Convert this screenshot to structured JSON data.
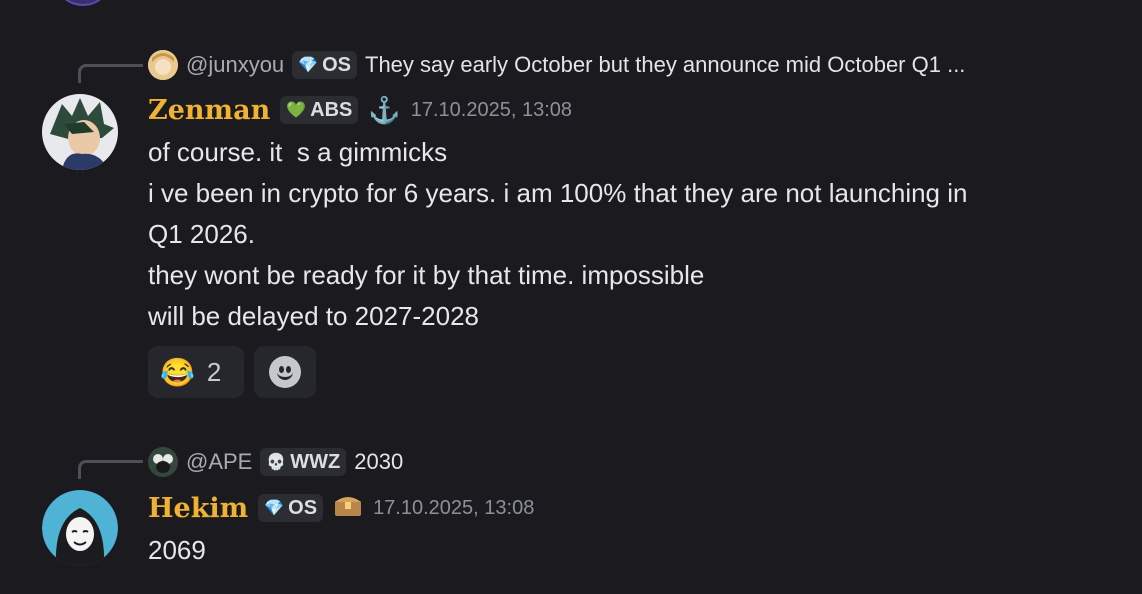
{
  "messages": [
    {
      "reply": {
        "username": "@junxyou",
        "tag": "OS",
        "tag_icon": "diamond",
        "text": "They say early October but they announce mid October  Q1 ..."
      },
      "author": "Zenman",
      "tag": "ABS",
      "tag_icon": "green-heart",
      "role_icon": "anchor",
      "timestamp": "17.10.2025, 13:08",
      "lines": [
        "of course. it  s a gimmicks",
        "i ve been in crypto for 6 years. i am 100% that they are not launching in",
        "Q1 2026.",
        "they wont be ready for it by that time. impossible",
        "will be delayed to 2027-2028"
      ],
      "reactions": [
        {
          "emoji": "😂",
          "count": "2"
        }
      ]
    },
    {
      "reply": {
        "username": "@APE",
        "tag": "WWZ",
        "tag_icon": "skull",
        "text": "2030"
      },
      "author": "Hekim",
      "tag": "OS",
      "tag_icon": "diamond",
      "role_icon": "treasure-chest",
      "timestamp": "17.10.2025, 13:08",
      "lines": [
        "2069"
      ]
    }
  ],
  "colors": {
    "background": "#1b1b1f",
    "username": "#f0b232",
    "timestamp": "#8e9099"
  }
}
